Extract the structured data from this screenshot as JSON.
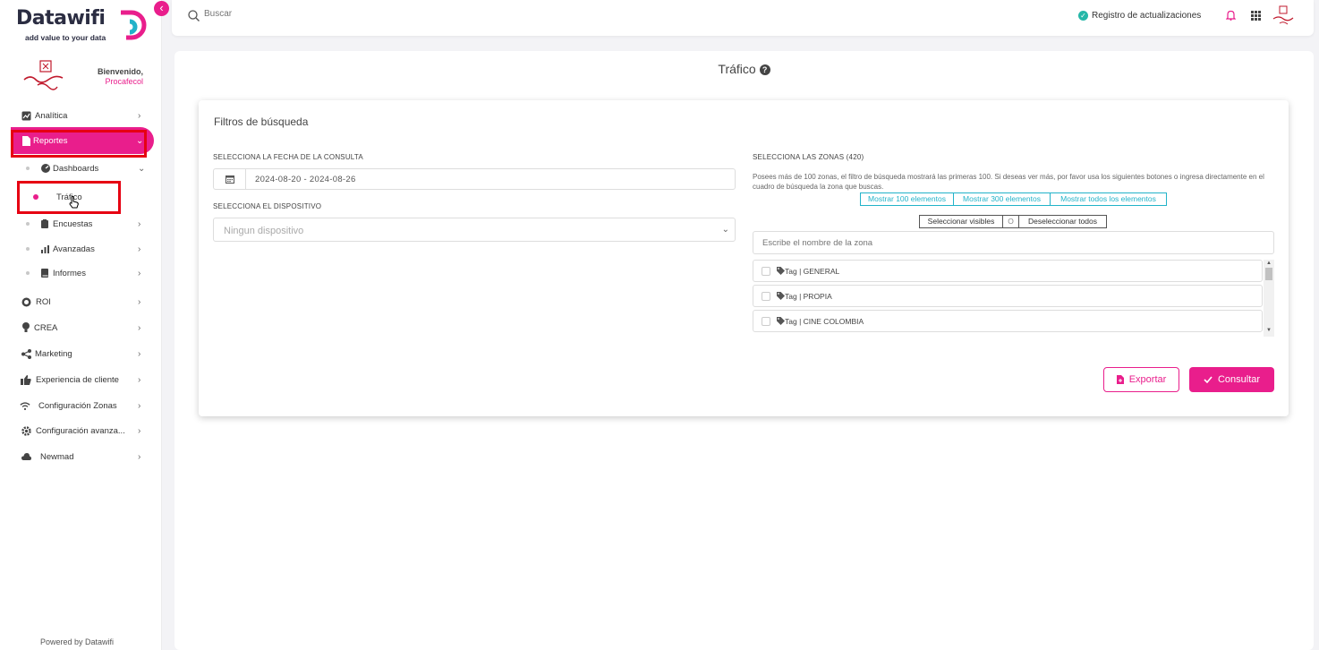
{
  "sidebar": {
    "logo_text": "Datawifi",
    "logo_tagline": "add value to your data",
    "welcome_title": "Bienvenido,",
    "welcome_user": "Procafecol",
    "collapse_icon": "‹",
    "items": [
      {
        "label": "Analítica",
        "icon": "chart-icon"
      },
      {
        "label": "Reportes",
        "icon": "document-icon"
      },
      {
        "label": "Dashboards",
        "icon": "dashboard-icon"
      },
      {
        "label": "Tráfico",
        "icon": "dot"
      },
      {
        "label": "Encuestas",
        "icon": "clipboard-icon"
      },
      {
        "label": "Avanzadas",
        "icon": "bar-chart-icon"
      },
      {
        "label": "Informes",
        "icon": "book-icon"
      },
      {
        "label": "ROI",
        "icon": "coins-icon"
      },
      {
        "label": "CREA",
        "icon": "lightbulb-icon"
      },
      {
        "label": "Marketing",
        "icon": "share-icon"
      },
      {
        "label": "Experiencia de cliente",
        "icon": "thumbs-up-icon"
      },
      {
        "label": "Configuración Zonas",
        "icon": "wifi-icon"
      },
      {
        "label": "Configuración avanza...",
        "icon": "gear-icon"
      },
      {
        "label": "Newmad",
        "icon": "cloud-icon"
      }
    ],
    "powered_by": "Powered by Datawifi"
  },
  "topbar": {
    "search_placeholder": "Buscar",
    "updates_label": "Registro de actualizaciones"
  },
  "page": {
    "title": "Tráfico",
    "help": "?"
  },
  "filters": {
    "title": "Filtros de búsqueda",
    "date_label": "SELECCIONA LA FECHA DE LA CONSULTA",
    "date_value": "2024-08-20 - 2024-08-26",
    "device_label": "SELECCIONA EL DISPOSITIVO",
    "device_value": "Ningun dispositivo",
    "zones_label": "SELECCIONA LAS ZONAS (420)",
    "zones_info": "Posees más de 100 zonas, el filtro de búsqueda mostrará las primeras 100. Si deseas ver más, por favor usa los siguientes botones o ingresa directamente en el cuadro de búsqueda la zona que buscas.",
    "show_buttons": [
      "Mostrar 100 elementos",
      "Mostrar 300 elementos",
      "Mostrar todos los elementos"
    ],
    "select_visible": "Seleccionar visibles",
    "separator": "O",
    "deselect_all": "Deseleccionar todos",
    "zone_search_placeholder": "Escribe el nombre de la zona",
    "zones": [
      "Tag | GENERAL",
      "Tag | PROPIA",
      "Tag | CINE COLOMBIA"
    ],
    "export_label": "Exportar",
    "consult_label": "Consultar"
  },
  "colors": {
    "accent": "#e91e8c",
    "teal": "#22b3c9",
    "highlight_box": "#e60012"
  }
}
